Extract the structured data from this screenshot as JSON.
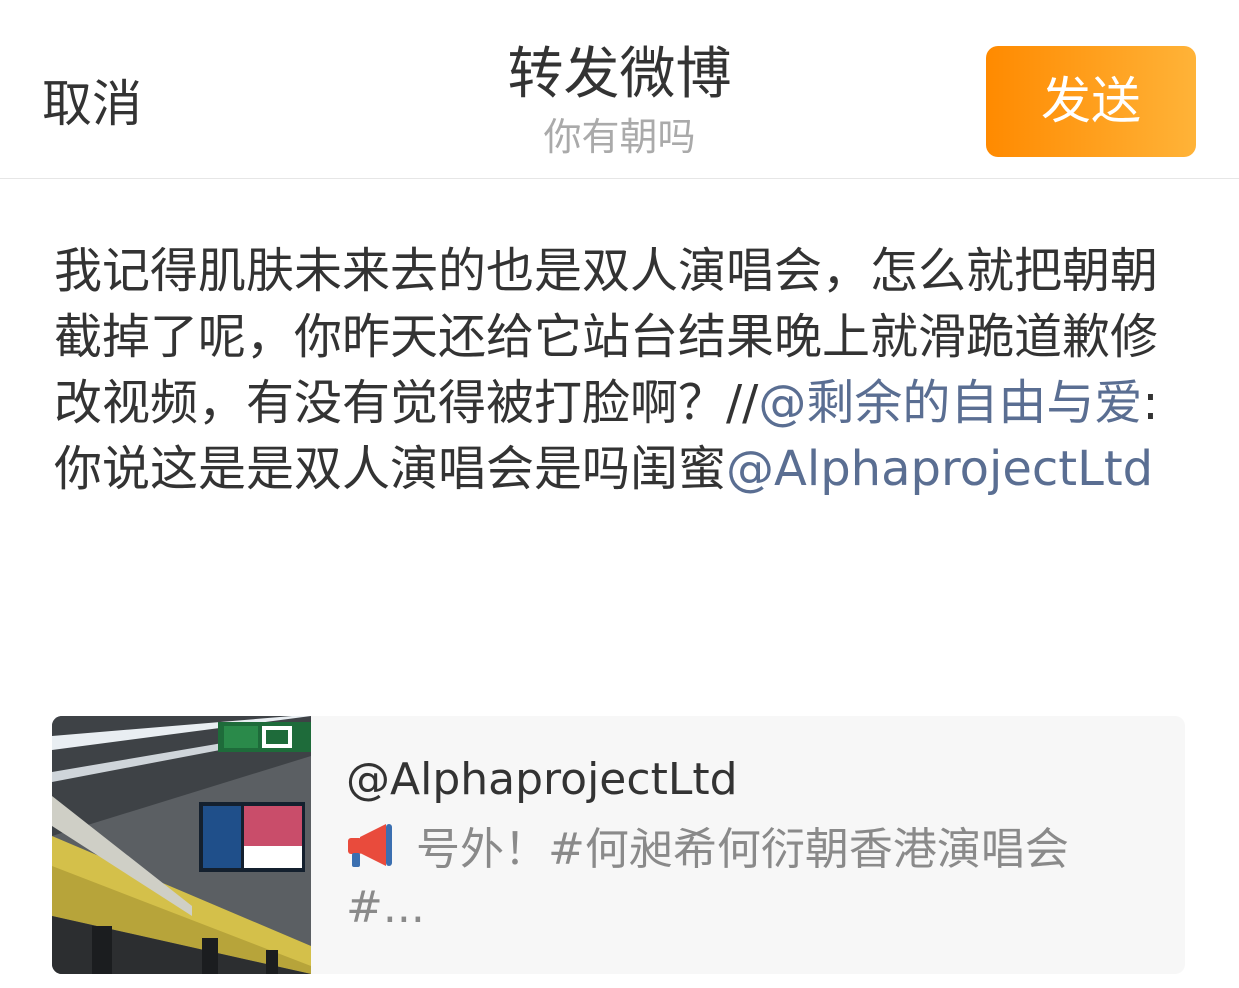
{
  "header": {
    "cancel_label": "取消",
    "title": "转发微博",
    "subtitle": "你有朝吗",
    "send_label": "发送"
  },
  "compose": {
    "text_part1": "我记得肌肤未来去的也是双人演唱会，怎么就把朝朝截掉了呢，你昨天还给它站台结果晚上就滑跪道歉修改视频，有没有觉得被打脸啊？//",
    "mention1": "@剩余的自由与爱",
    "text_part2": ":你说这是是双人演唱会是吗闺蜜",
    "mention2": "@AlphaprojectLtd"
  },
  "card": {
    "user": "@AlphaprojectLtd",
    "text": "号外！#何昶希何衍朝香港演唱会#...",
    "icon": "megaphone-icon"
  },
  "colors": {
    "accent_start": "#ff8a00",
    "accent_end": "#ffb338",
    "mention": "#5a6e92"
  }
}
